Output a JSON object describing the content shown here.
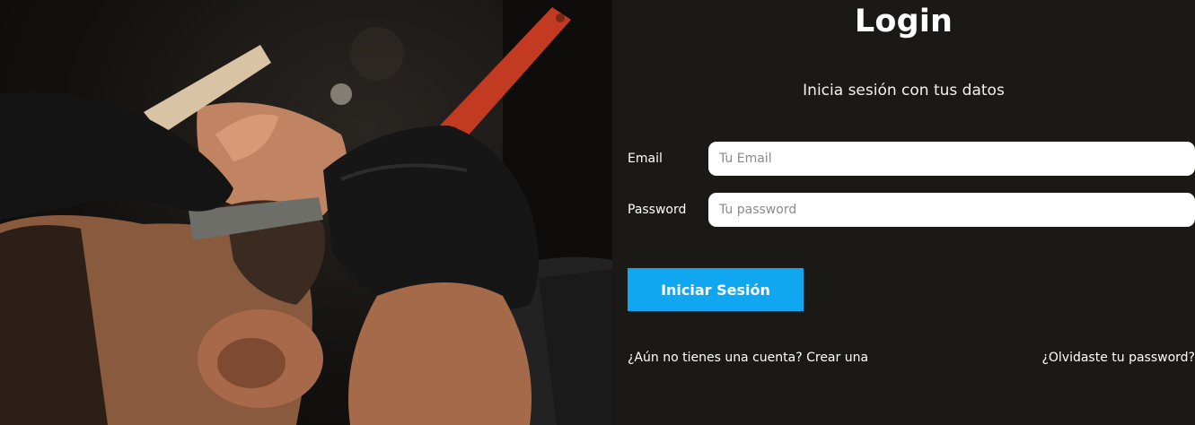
{
  "photo": {
    "alt_icon": "barber-shave-photo"
  },
  "login": {
    "title": "Login",
    "subtitle": "Inicia sesión con tus datos",
    "email": {
      "label": "Email",
      "placeholder": "Tu Email",
      "value": ""
    },
    "password": {
      "label": "Password",
      "placeholder": "Tu password",
      "value": ""
    },
    "submit_label": "Iniciar Sesión",
    "signup_link": "¿Aún no tienes una cuenta? Crear una",
    "forgot_link": "¿Olvidaste tu password?"
  },
  "colors": {
    "background": "#1a1915",
    "accent": "#10a6f0",
    "input_bg": "#ffffff",
    "text": "#ffffff"
  }
}
